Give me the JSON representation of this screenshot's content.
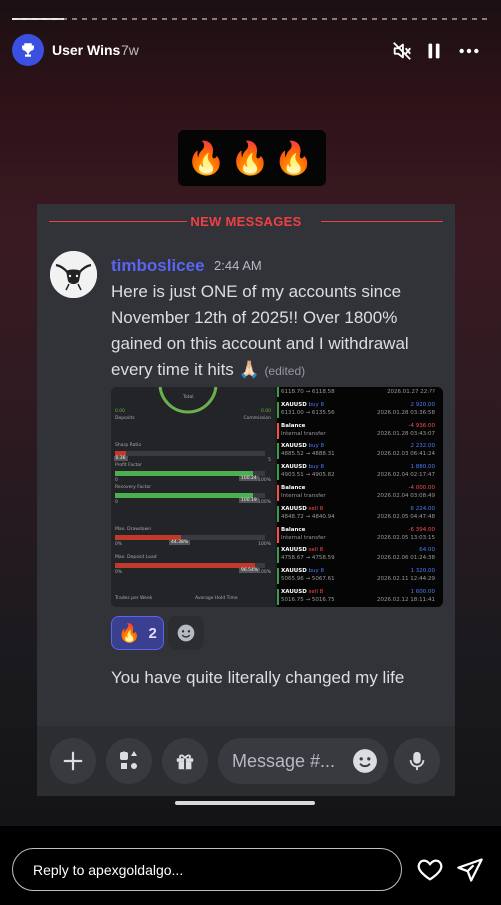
{
  "story": {
    "username": "User Wins",
    "posted_ago": "7w",
    "sticker_emojis": "🔥🔥🔥",
    "progress": {
      "viewed_fraction": 0.11
    }
  },
  "discord": {
    "divider_label": "NEW MESSAGES",
    "message": {
      "author": "timboslicee",
      "time": "2:44 AM",
      "text": "Here is just ONE of my accounts since November 12th of 2025!! Over 1800% gained on this account and I withdrawal every time it hits 🙏🏻",
      "edited": "(edited)"
    },
    "screenshot": {
      "left_panel": {
        "top_label": "Total",
        "deposits_value": "0.00",
        "deposits_label": "Deposits",
        "commission_value": "0.00",
        "commission_label": "Commission",
        "metrics": [
          {
            "label": "Sharp Ratio",
            "min": "0",
            "max": "5",
            "badge": "0.36",
            "fill": 0.07,
            "color": "#c0392b"
          },
          {
            "label": "Profit Factor",
            "min": "0",
            "max": "100%",
            "badge": "100.24",
            "fill": 0.92,
            "color": "#4caf50"
          },
          {
            "label": "Recovery Factor",
            "min": "0",
            "max": "100%",
            "badge": "100.19",
            "fill": 0.92,
            "color": "#4caf50"
          },
          {
            "label": "Max. Drawdown",
            "min": "0%",
            "max": "100%",
            "badge": "44.38%",
            "fill": 0.44,
            "color": "#c0392b"
          },
          {
            "label": "Max. Deposit Load",
            "min": "0%",
            "max": "100%",
            "badge": "96.54%",
            "fill": 0.93,
            "color": "#c0392b"
          }
        ],
        "bottom_left": "Trades per Week",
        "bottom_right": "Average Hold Time"
      },
      "right_panel": {
        "rows": [
          {
            "symbol": "",
            "action": "",
            "value": "",
            "sub": "6118.70 → 6118.58",
            "date": "2026.01.27 22:??"
          },
          {
            "symbol": "XAUUSD",
            "action": "buy 8",
            "value": "2 920.00",
            "value_color": "#4a7cff",
            "sub": "6131.00 → 6135.56",
            "date": "2026.01.28 03:36:58"
          },
          {
            "symbol": "Balance",
            "action": "",
            "value": "-4 936.00",
            "value_color": "#ff4a4a",
            "sub": "Internal transfer",
            "date": "2026.01.28 03:43:07"
          },
          {
            "symbol": "XAUUSD",
            "action": "buy 8",
            "value": "2 232.00",
            "value_color": "#4a7cff",
            "sub": "4885.52 → 4888.31",
            "date": "2026.02.03 06:41:24"
          },
          {
            "symbol": "XAUUSD",
            "action": "buy 8",
            "value": "1 880.00",
            "value_color": "#4a7cff",
            "sub": "4903.51 → 4905.82",
            "date": "2026.02.04 02:17:47"
          },
          {
            "symbol": "Balance",
            "action": "",
            "value": "-4 000.00",
            "value_color": "#ff4a4a",
            "sub": "Internal transfer",
            "date": "2026.02.04 03:08:49"
          },
          {
            "symbol": "XAUUSD",
            "action": "sell 8",
            "value": "6 224.00",
            "value_color": "#4a7cff",
            "sub": "4848.72 → 4840.94",
            "date": "2026.02.05 04:47:48"
          },
          {
            "symbol": "Balance",
            "action": "",
            "value": "-6 394.00",
            "value_color": "#ff4a4a",
            "sub": "Internal transfer",
            "date": "2026.02.05 13:03:15"
          },
          {
            "symbol": "XAUUSD",
            "action": "sell 8",
            "value": "64.00",
            "value_color": "#4a7cff",
            "sub": "4758.67 → 4758.59",
            "date": "2026.02.06 01:24:38"
          },
          {
            "symbol": "XAUUSD",
            "action": "buy 8",
            "value": "1 320.00",
            "value_color": "#4a7cff",
            "sub": "5065.96 → 5067.61",
            "date": "2026.02.11 12:44:29"
          },
          {
            "symbol": "XAUUSD",
            "action": "sell 8",
            "value": "1 600.00",
            "value_color": "#4a7cff",
            "sub": "5016.75 → 5016.75",
            "date": "2026.02.12 18:11:41"
          }
        ]
      }
    },
    "reactions": [
      {
        "emoji": "🔥",
        "count": "2"
      }
    ],
    "message2": "You have quite literally changed my life",
    "composer": {
      "placeholder": "Message #..."
    }
  },
  "reply": {
    "placeholder": "Reply to apexgoldalgo..."
  },
  "icons": [
    "trophy-icon",
    "mute-icon",
    "pause-icon",
    "more-icon",
    "plus-icon",
    "apps-icon",
    "gift-icon",
    "emoji-icon",
    "mic-icon",
    "heart-icon",
    "send-icon",
    "add-reaction-icon"
  ]
}
